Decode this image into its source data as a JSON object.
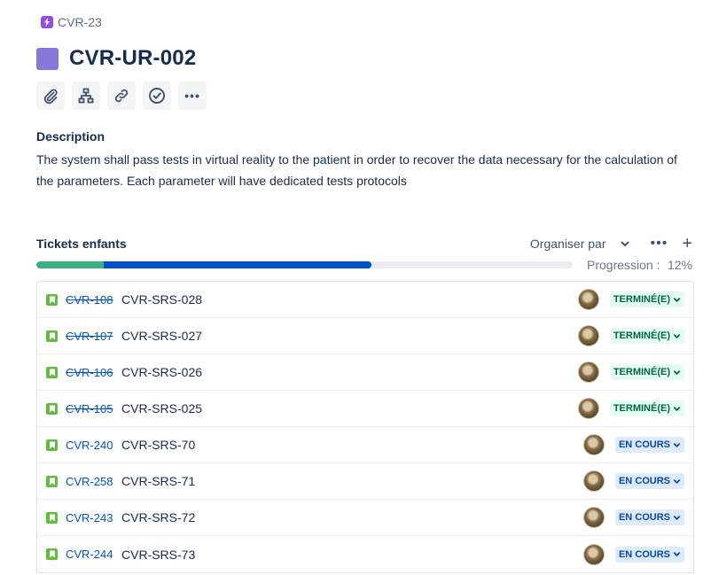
{
  "parent": {
    "key": "CVR-23",
    "icon": "epic-lightning-icon"
  },
  "issue": {
    "title": "CVR-UR-002"
  },
  "toolbar": {
    "buttons": [
      {
        "name": "attach-button",
        "icon": "paperclip-icon"
      },
      {
        "name": "child-issue-button",
        "icon": "hierarchy-icon"
      },
      {
        "name": "link-issue-button",
        "icon": "link-icon"
      },
      {
        "name": "approve-button",
        "icon": "check-circle-icon"
      },
      {
        "name": "more-actions-button",
        "icon": "more-icon",
        "label": "•••"
      }
    ]
  },
  "description": {
    "label": "Description",
    "text": "The system shall pass tests in virtual reality to the patient in order to recover the data necessary for the calculation of the parameters. Each parameter will have dedicated tests protocols"
  },
  "children": {
    "title": "Tickets enfants",
    "sort_label": "Organiser par",
    "more_label": "•••",
    "add_label": "+",
    "progress_label": "Progression :",
    "progress_value": "12%",
    "progress_done_fraction": 0.125,
    "progress_inprogress_fraction": 0.5,
    "items": [
      {
        "key": "CVR-108",
        "summary": "CVR-SRS-028",
        "status": "TERMINÉ(E)",
        "done": true
      },
      {
        "key": "CVR-107",
        "summary": "CVR-SRS-027",
        "status": "TERMINÉ(E)",
        "done": true
      },
      {
        "key": "CVR-106",
        "summary": "CVR-SRS-026",
        "status": "TERMINÉ(E)",
        "done": true
      },
      {
        "key": "CVR-105",
        "summary": "CVR-SRS-025",
        "status": "TERMINÉ(E)",
        "done": true
      },
      {
        "key": "CVR-240",
        "summary": "CVR-SRS-70",
        "status": "EN COURS",
        "done": false
      },
      {
        "key": "CVR-258",
        "summary": "CVR-SRS-71",
        "status": "EN COURS",
        "done": false
      },
      {
        "key": "CVR-243",
        "summary": "CVR-SRS-72",
        "status": "EN COURS",
        "done": false
      },
      {
        "key": "CVR-244",
        "summary": "CVR-SRS-73",
        "status": "EN COURS",
        "done": false
      }
    ]
  },
  "colors": {
    "done_status": "#006644",
    "inprogress_status": "#0747a6",
    "progress_done": "#36b37e",
    "progress_inprogress": "#0052cc"
  }
}
